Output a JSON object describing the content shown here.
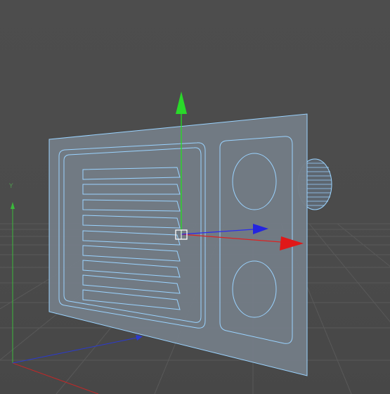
{
  "viewport": {
    "background": "#4a4a4a",
    "grid_color": "#5a5a5a",
    "world_axis_label_y": "Y"
  },
  "object": {
    "name": "microwave-front-panel",
    "state": "selected",
    "wireframe_color": "#9ad3ff",
    "fill_color": "#737c85",
    "vent_slot_count": 9,
    "knob_count": 2
  },
  "gizmo": {
    "type": "move",
    "x_axis_color": "#e02020",
    "y_axis_color": "#22dd22",
    "z_axis_color": "#2a2aee"
  },
  "world_axes": {
    "x_color": "#c02828",
    "y_color": "#3bb83b",
    "z_color": "#2a3ad0"
  }
}
